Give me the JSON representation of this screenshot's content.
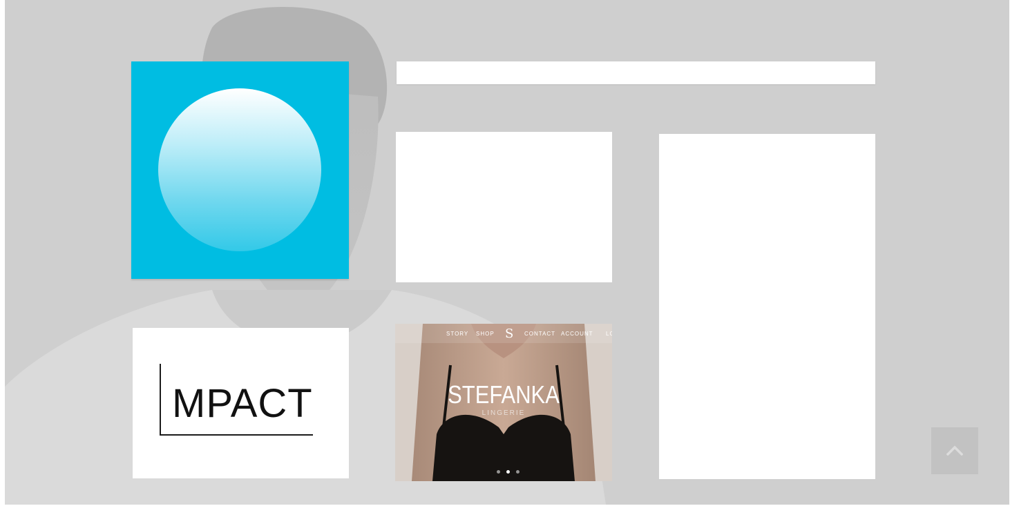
{
  "portfolio": {
    "impact_tile": {
      "logo_text": "MPACT"
    },
    "stefanka_tile": {
      "nav": {
        "story": "STORY",
        "shop": "SHOP",
        "logo_glyph": "S",
        "contact": "CONTACT",
        "account": "ACCOUNT",
        "login": "LO"
      },
      "title": "STEFANKA",
      "subtitle": "LINGERIE",
      "carousel": {
        "count": 3,
        "active_index": 1
      }
    },
    "blue_tile": {
      "colors": {
        "background": "#00bde2",
        "orb_top": "#ffffff",
        "orb_bottom": "#33c9e8"
      }
    }
  },
  "controls": {
    "back_to_top_icon": "chevron-up-icon"
  },
  "colors": {
    "page_background": "#cfcfcf",
    "tile_background": "#ffffff"
  }
}
